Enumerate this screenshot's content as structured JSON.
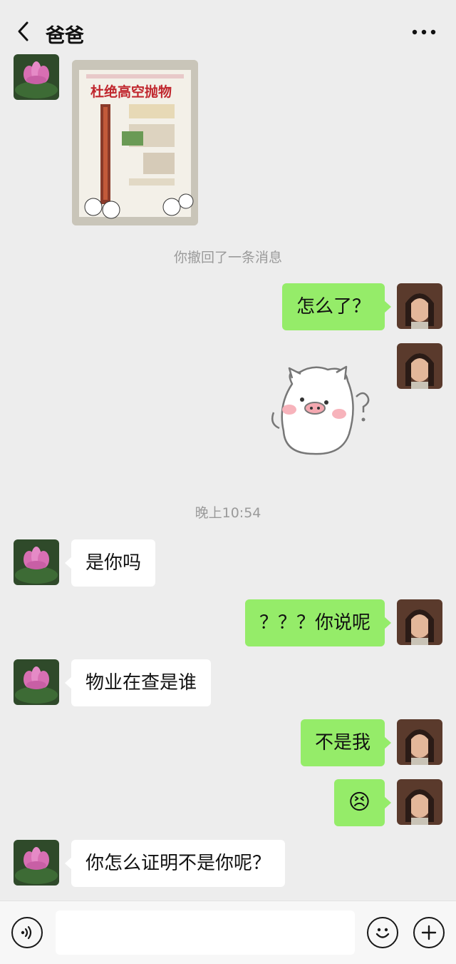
{
  "header": {
    "title": "爸爸",
    "back_icon": "chevron-left-icon",
    "more_icon": "more-dots-icon"
  },
  "poster": {
    "title": "杜绝高空抛物"
  },
  "system": {
    "recalled": "你撤回了一条消息",
    "time": "晚上10:54"
  },
  "messages": {
    "m1": "怎么了？",
    "m2": "是你吗",
    "m3": "？？？你说呢",
    "m4": "物业在查是谁",
    "m5": "不是我",
    "m6": "😣",
    "m7": "你怎么证明不是你呢？"
  },
  "footer": {
    "voice_icon": "voice-icon",
    "emoji_icon": "emoji-icon",
    "add_icon": "plus-icon",
    "input_value": ""
  },
  "colors": {
    "outgoing_bubble": "#95ec69",
    "incoming_bubble": "#ffffff",
    "background": "#ededed"
  }
}
